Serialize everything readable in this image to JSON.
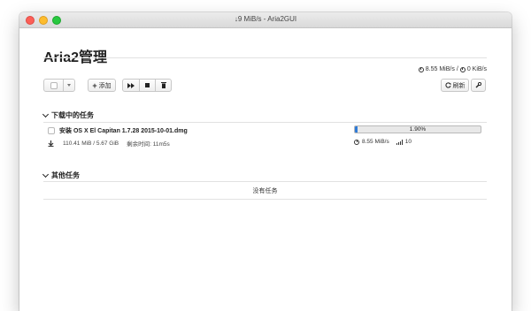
{
  "window": {
    "title": "↓9 MiB/s - Aria2GUI"
  },
  "header": {
    "app_title": "Aria2管理",
    "download_speed": "8.55 MiB/s",
    "upload_speed": "0 KiB/s"
  },
  "toolbar": {
    "add_label": "添加",
    "refresh_label": "刷新"
  },
  "sections": {
    "active_title": "下载中的任务",
    "other_title": "其他任务",
    "other_empty": "没有任务"
  },
  "task": {
    "name": "安装 OS X El Capitan 1.7.28 2015-10-01.dmg",
    "size": "110.41 MiB / 5.67 GiB",
    "remaining": "剩余时间: 11m5s",
    "progress_text": "1.90%",
    "progress_value": 0.019,
    "speed": "8.55 MiB/s",
    "connections": "10"
  },
  "colors": {
    "progress": "#2f7bd6",
    "close": "#fc5f57",
    "minimize": "#fdbc2e",
    "zoom": "#28c840"
  },
  "icons": [
    "play-fast-icon",
    "stop-icon",
    "trash-icon",
    "refresh-icon",
    "wrench-icon",
    "clock-icon",
    "download-icon",
    "signal-bars-icon",
    "plus-icon",
    "chevron-down-icon"
  ]
}
